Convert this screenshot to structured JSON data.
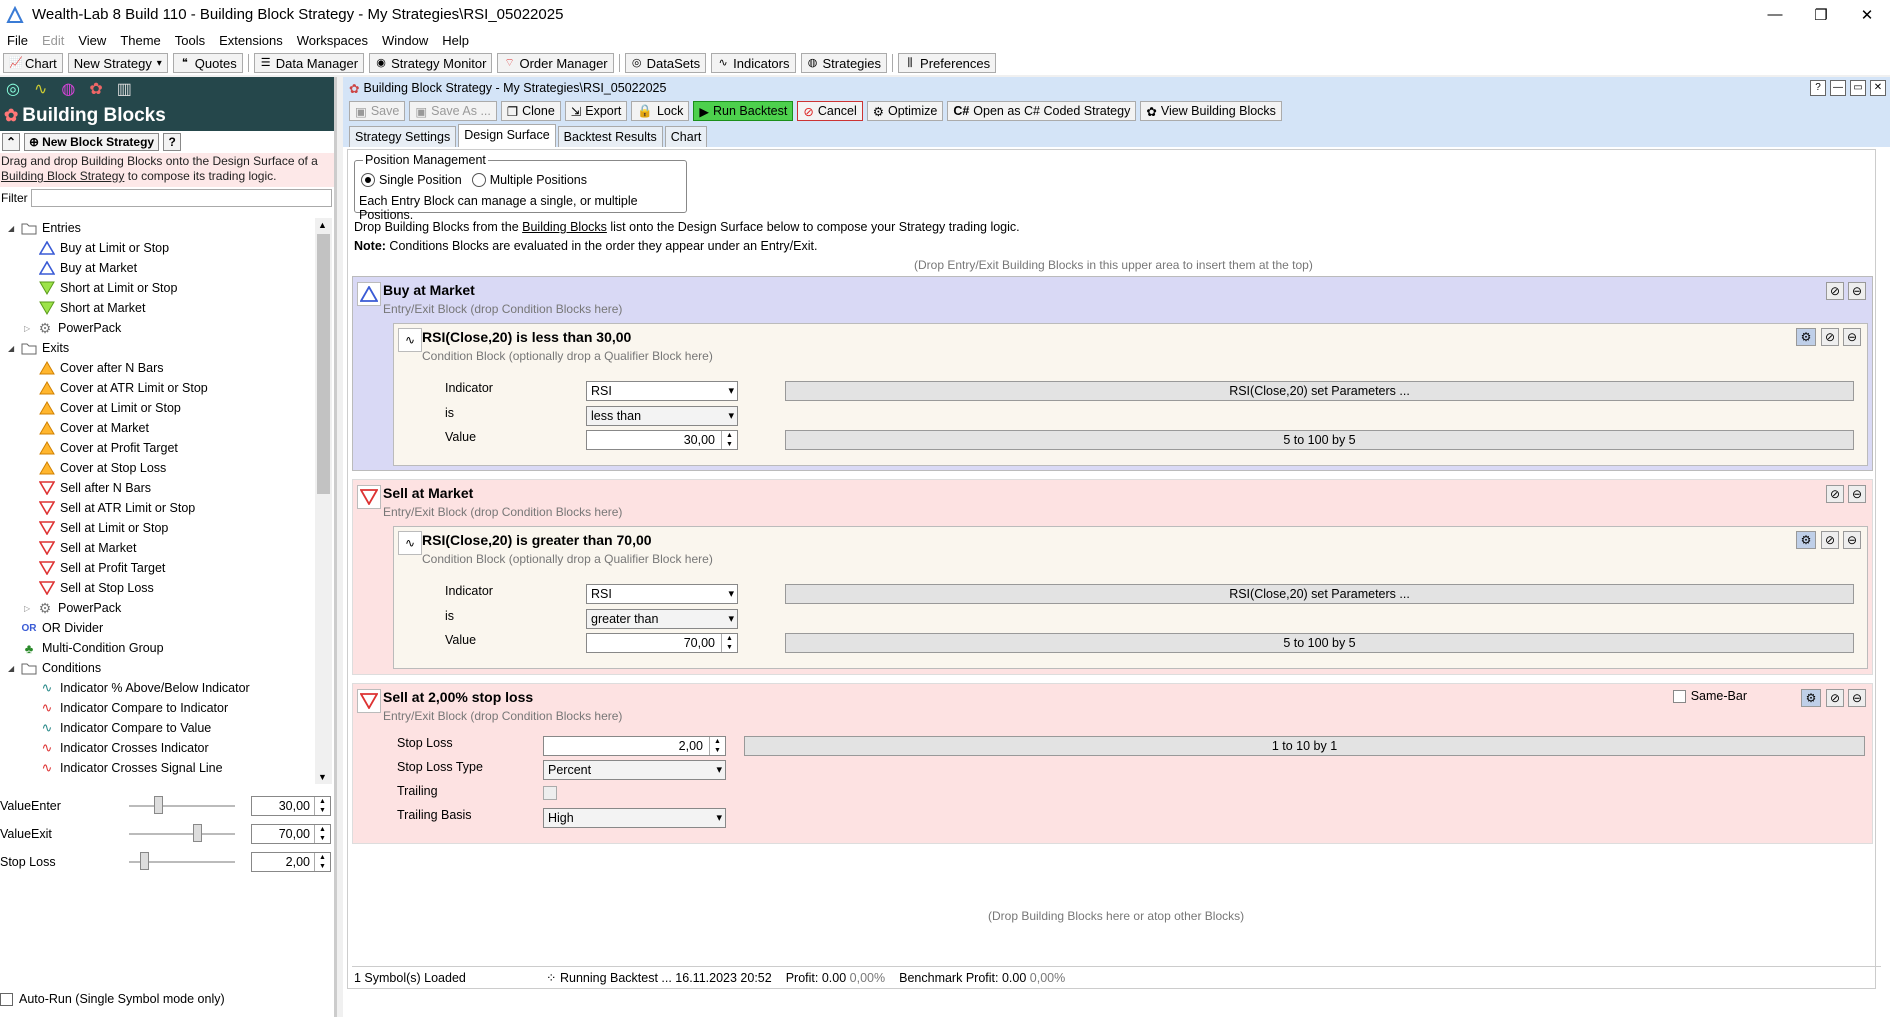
{
  "window": {
    "title": "Wealth-Lab 8 Build 110 - Building Block Strategy - My Strategies\\RSI_05022025"
  },
  "menu": [
    "File",
    "Edit",
    "View",
    "Theme",
    "Tools",
    "Extensions",
    "Workspaces",
    "Window",
    "Help"
  ],
  "toolbar": {
    "chart": "Chart",
    "new_strategy": "New Strategy",
    "quotes": "Quotes",
    "data_manager": "Data Manager",
    "strategy_monitor": "Strategy Monitor",
    "order_manager": "Order Manager",
    "datasets": "DataSets",
    "indicators": "Indicators",
    "strategies": "Strategies",
    "preferences": "Preferences"
  },
  "left": {
    "header": "Building Blocks",
    "new_block": "New Block Strategy",
    "help": "?",
    "desc_pre": "Drag and drop Building Blocks onto the Design Surface of a ",
    "desc_link": "Building Block Strategy",
    "desc_post": " to compose its trading logic.",
    "filter_label": "Filter",
    "tree": [
      {
        "label": "Entries",
        "type": "folder",
        "level": 0
      },
      {
        "label": "Buy at Limit or Stop",
        "type": "buy",
        "level": 1
      },
      {
        "label": "Buy at Market",
        "type": "buy",
        "level": 1
      },
      {
        "label": "Short at Limit or Stop",
        "type": "short",
        "level": 1
      },
      {
        "label": "Short at Market",
        "type": "short",
        "level": 1
      },
      {
        "label": "PowerPack",
        "type": "gear",
        "level": 1
      },
      {
        "label": "Exits",
        "type": "folder",
        "level": 0
      },
      {
        "label": "Cover after N Bars",
        "type": "cover",
        "level": 1
      },
      {
        "label": "Cover at ATR Limit or Stop",
        "type": "cover",
        "level": 1
      },
      {
        "label": "Cover at Limit or Stop",
        "type": "cover",
        "level": 1
      },
      {
        "label": "Cover at Market",
        "type": "cover",
        "level": 1
      },
      {
        "label": "Cover at Profit Target",
        "type": "cover",
        "level": 1
      },
      {
        "label": "Cover at Stop Loss",
        "type": "cover",
        "level": 1
      },
      {
        "label": "Sell after N Bars",
        "type": "sell",
        "level": 1
      },
      {
        "label": "Sell at ATR Limit or Stop",
        "type": "sell",
        "level": 1
      },
      {
        "label": "Sell at Limit or Stop",
        "type": "sell",
        "level": 1
      },
      {
        "label": "Sell at Market",
        "type": "sell",
        "level": 1
      },
      {
        "label": "Sell at Profit Target",
        "type": "sell",
        "level": 1
      },
      {
        "label": "Sell at Stop Loss",
        "type": "sell",
        "level": 1
      },
      {
        "label": "PowerPack",
        "type": "gear",
        "level": 1
      },
      {
        "label": "OR Divider",
        "type": "or",
        "level": 0
      },
      {
        "label": "Multi-Condition Group",
        "type": "group",
        "level": 0
      },
      {
        "label": "Conditions",
        "type": "folder",
        "level": 0
      },
      {
        "label": "Indicator % Above/Below Indicator",
        "type": "ind",
        "level": 1
      },
      {
        "label": "Indicator Compare to Indicator",
        "type": "ind2",
        "level": 1
      },
      {
        "label": "Indicator Compare to Value",
        "type": "ind",
        "level": 1
      },
      {
        "label": "Indicator Crosses Indicator",
        "type": "ind2",
        "level": 1
      },
      {
        "label": "Indicator Crosses Signal Line",
        "type": "ind2",
        "level": 1
      }
    ],
    "sliders": [
      {
        "label": "ValueEnter",
        "value": "30,00",
        "pos": 0.26
      },
      {
        "label": "ValueExit",
        "value": "70,00",
        "pos": 0.66
      },
      {
        "label": "Stop Loss",
        "value": "2,00",
        "pos": 0.11
      }
    ],
    "autorun": "Auto-Run (Single Symbol mode only)"
  },
  "main": {
    "title": "Building Block Strategy - My Strategies\\RSI_05022025",
    "tools": {
      "save": "Save",
      "save_as": "Save As ...",
      "clone": "Clone",
      "export": "Export",
      "lock": "Lock",
      "run": "Run Backtest",
      "cancel": "Cancel",
      "optimize": "Optimize",
      "open_cs": "Open as C# Coded Strategy",
      "view_bb": "View Building Blocks"
    },
    "tabs": [
      "Strategy Settings",
      "Design Surface",
      "Backtest Results",
      "Chart"
    ],
    "posmgmt": {
      "title": "Position Management",
      "single": "Single Position",
      "multiple": "Multiple Positions",
      "note": "Each Entry Block can manage a single, or multiple Positions."
    },
    "info_pre": "Drop Building Blocks from the ",
    "info_link": "Building Blocks",
    "info_post": " list onto the Design Surface below to compose your Strategy trading logic.",
    "note_bold": "Note:",
    "note_text": " Conditions Blocks are evaluated in the order they appear under an Entry/Exit.",
    "top_hint": "(Drop Entry/Exit Building Blocks in this upper area to insert them at the top)",
    "bottom_hint": "(Drop Building Blocks here or atop other Blocks)",
    "entry_sub": "Entry/Exit Block (drop Condition Blocks here)",
    "cond_sub": "Condition Block (optionally drop a Qualifier Block here)",
    "block1": {
      "title": "Buy at Market",
      "cond_title": "RSI(Close,20) is less than 30,00",
      "ind_label": "Indicator",
      "ind": "RSI",
      "ind_params": "RSI(Close,20) set Parameters ...",
      "is_label": "is",
      "is": "less than",
      "val_label": "Value",
      "val": "30,00",
      "range": "5 to 100 by 5"
    },
    "block2": {
      "title": "Sell at Market",
      "cond_title": "RSI(Close,20) is greater than 70,00",
      "ind_label": "Indicator",
      "ind": "RSI",
      "ind_params": "RSI(Close,20) set Parameters ...",
      "is_label": "is",
      "is": "greater than",
      "val_label": "Value",
      "val": "70,00",
      "range": "5 to 100 by 5"
    },
    "block3": {
      "title": "Sell at 2,00% stop loss",
      "same_bar": "Same-Bar",
      "sl_label": "Stop Loss",
      "sl": "2,00",
      "sl_range": "1 to 10 by 1",
      "type_label": "Stop Loss Type",
      "type": "Percent",
      "trail_label": "Trailing",
      "basis_label": "Trailing Basis",
      "basis": "High"
    },
    "status": {
      "symbols": "1 Symbol(s) Loaded",
      "running": "Running Backtest ... 16.11.2023 20:52",
      "profit_label": "Profit:",
      "profit": "0.00",
      "profit_pct": "0,00%",
      "bench_label": "Benchmark Profit:",
      "bench": "0.00",
      "bench_pct": "0,00%"
    }
  },
  "colors": {
    "entry_bg": "#d9d9f5",
    "exit_bg": "#fde2e2",
    "left_header": "#25474b",
    "run_green": "#4dd04d"
  }
}
